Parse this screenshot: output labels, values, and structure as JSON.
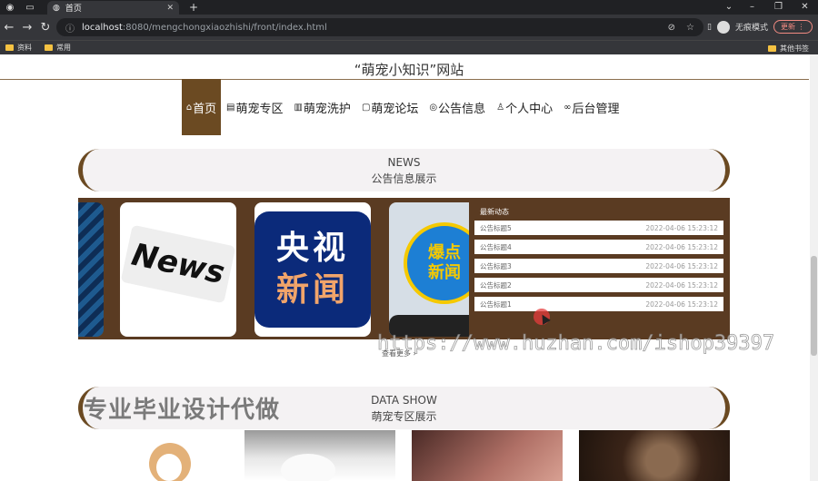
{
  "browser": {
    "tab_title": "首页",
    "url_host": "localhost",
    "url_rest": ":8080/mengchongxiaozhishi/front/index.html",
    "profile_label": "无痕模式",
    "update_label": "更新",
    "bookmarks": [
      "资料",
      "常用"
    ],
    "other_bookmarks": "其他书签"
  },
  "site": {
    "title": "“萌宠小知识”网站"
  },
  "nav": {
    "items": [
      {
        "icon": "⌂",
        "label": "首页"
      },
      {
        "icon": "▤",
        "label": "萌宠专区"
      },
      {
        "icon": "▥",
        "label": "萌宠洗护"
      },
      {
        "icon": "▢",
        "label": "萌宠论坛"
      },
      {
        "icon": "◎",
        "label": "公告信息"
      },
      {
        "icon": "♙",
        "label": "个人中心"
      },
      {
        "icon": "∞",
        "label": "后台管理"
      }
    ]
  },
  "news_banner": {
    "en": "NEWS",
    "cn": "公告信息展示"
  },
  "carousel": {
    "slide1_text": "News",
    "slide2_line1": "央视",
    "slide2_line2": "新闻",
    "slide3_line1": "爆点",
    "slide3_line2": "新闻"
  },
  "latest": {
    "title": "最新动态",
    "items": [
      {
        "title": "公告标题5",
        "date": "2022-04-06 15:23:12"
      },
      {
        "title": "公告标题4",
        "date": "2022-04-06 15:23:12"
      },
      {
        "title": "公告标题3",
        "date": "2022-04-06 15:23:12"
      },
      {
        "title": "公告标题2",
        "date": "2022-04-06 15:23:12"
      },
      {
        "title": "公告标题1",
        "date": "2022-04-06 15:23:12"
      }
    ]
  },
  "more_link": "查看更多 ›",
  "data_banner": {
    "en": "DATA SHOW",
    "cn": "萌宠专区展示"
  },
  "overlay_text": "专业毕业设计代做",
  "watermark": "https://www.huzhan.com/ishop39397",
  "colors": {
    "accent": "#6b4a22",
    "panel": "#5a3b22"
  }
}
